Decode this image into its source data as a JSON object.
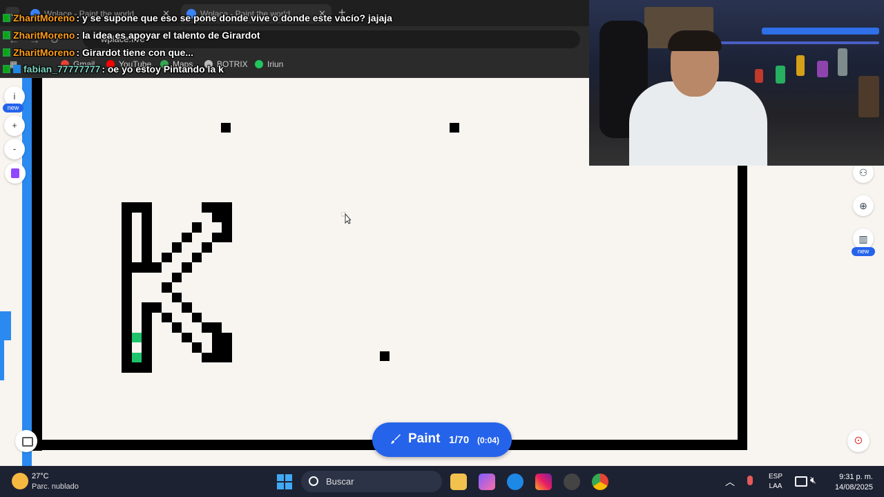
{
  "browser": {
    "tabs": [
      {
        "title": "Wplace - Paint the world"
      },
      {
        "title": "Wplace - Paint the world"
      }
    ],
    "url": "wplace.live",
    "bookmarks": [
      "Gmail",
      "YouTube",
      "Maps",
      "BOTRIX",
      "Iriun"
    ]
  },
  "chat": [
    {
      "user": "ZharitMoreno",
      "text": ": y se supone que eso se pone donde vive o donde este vacío? jajaja",
      "user_color": "#ff9f1a"
    },
    {
      "user": "ZharitMoreno",
      "text": ": la idea es apoyar el talento de Girardot",
      "user_color": "#ff9f1a"
    },
    {
      "user": "ZharitMoreno",
      "text": ": Girardot tiene con que...",
      "user_color": "#ff9f1a"
    },
    {
      "user": "fabian_77777777",
      "text": ": oe yo estoy Pintando la k",
      "user_color": "#7dd3c0"
    }
  ],
  "left_tools": {
    "info": "i",
    "new_badge": "new",
    "zoom_in": "+",
    "zoom_out": "-"
  },
  "right_tools": {
    "new_badge": "new"
  },
  "paint": {
    "label": "Paint",
    "count": "1/70",
    "timer": "(0:04)"
  },
  "colors": {
    "accent": "#2563eb",
    "pixel": "#000000",
    "placed_pixel": "#1ec46b",
    "canvas_bg": "#f8f4f0"
  },
  "taskbar": {
    "weather_temp": "27°C",
    "weather_desc": "Parc. nublado",
    "search_placeholder": "Buscar",
    "lang_top": "ESP",
    "lang_bottom": "LAA",
    "time": "9:31 p. m.",
    "date": "14/08/2025"
  }
}
